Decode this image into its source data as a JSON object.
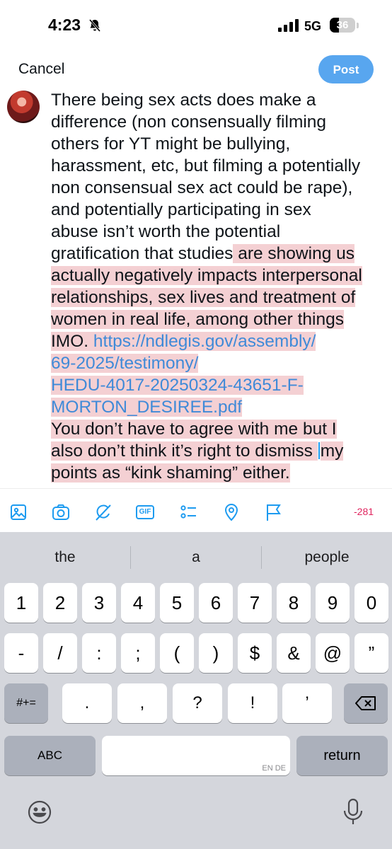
{
  "status_bar": {
    "time": "4:23",
    "network": "5G",
    "battery": "36",
    "battery_level": 0.36
  },
  "header": {
    "cancel_label": "Cancel",
    "post_label": "Post"
  },
  "tweet": {
    "lines": [
      [
        {
          "t": "There being sex acts does make a",
          "hl": false
        }
      ],
      [
        {
          "t": "difference (non consensually filming",
          "hl": false
        }
      ],
      [
        {
          "t": "others for YT might be bullying,",
          "hl": false
        }
      ],
      [
        {
          "t": "harassment, etc, but filming a potentially",
          "hl": false
        }
      ],
      [
        {
          "t": "non consensual sex act could be rape),",
          "hl": false
        }
      ],
      [
        {
          "t": "and potentially participating in sex",
          "hl": false
        }
      ],
      [
        {
          "t": "abuse isn’t worth the potential",
          "hl": false
        }
      ],
      [
        {
          "t": "gratification that studies",
          "hl": false
        },
        {
          "t": " are showing us",
          "hl": true
        }
      ],
      [
        {
          "t": "actually negatively impacts interpersonal",
          "hl": true
        }
      ],
      [
        {
          "t": "relationships, sex lives and treatment of",
          "hl": true
        }
      ],
      [
        {
          "t": "women in real  life, among other things",
          "hl": true
        }
      ],
      [
        {
          "t": "IMO. ",
          "hl": true
        },
        {
          "t": "https://ndlegis.gov/assembly/",
          "hl": true,
          "link": true
        }
      ],
      [
        {
          "t": "69-2025/testimony/",
          "hl": true,
          "link": true
        }
      ],
      [
        {
          "t": "HEDU-4017-20250324-43651-F-",
          "hl": true,
          "link": true
        }
      ],
      [
        {
          "t": "MORTON_DESIREE.pdf",
          "hl": true,
          "link": true
        }
      ],
      [
        {
          "t": "You don’t have to agree with me but I",
          "hl": true
        }
      ],
      [
        {
          "t": "also don’t think it’s right to dismiss ",
          "hl": true
        },
        {
          "caret": true
        },
        {
          "t": "my",
          "hl": true
        }
      ],
      [
        {
          "t": "points as “kink shaming” either.",
          "hl": true
        }
      ]
    ]
  },
  "toolbar": {
    "icons": [
      "image-icon",
      "camera-icon",
      "grok-icon",
      "gif-icon",
      "poll-icon",
      "location-icon",
      "flag-icon"
    ],
    "gif_label": "GIF",
    "char_count": "-281"
  },
  "keyboard": {
    "suggestions": [
      "the",
      "a",
      "people"
    ],
    "row1": [
      "1",
      "2",
      "3",
      "4",
      "5",
      "6",
      "7",
      "8",
      "9",
      "0"
    ],
    "row2": [
      "-",
      "/",
      ":",
      ";",
      "(",
      ")",
      "$",
      "&",
      "@",
      "”"
    ],
    "row3_mode": "#+=",
    "row3": [
      ".",
      ",",
      "?",
      "!",
      "’"
    ],
    "abc_label": "ABC",
    "space_lang": "EN DE",
    "return_label": "return"
  }
}
